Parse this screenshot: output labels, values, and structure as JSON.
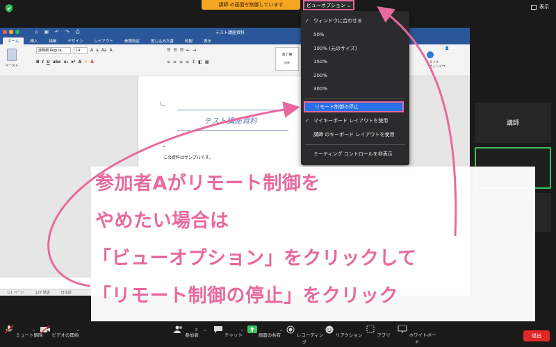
{
  "topbar": {
    "control_banner": "講師 の画面を制御しています",
    "view_option": "ビューオプション",
    "view_option_caret": "⌄",
    "right_view": "表示"
  },
  "word": {
    "title": "テスト講座資料",
    "tabs": [
      "ホーム",
      "挿入",
      "描画",
      "デザイン",
      "レイアウト",
      "参照設定",
      "差し込み文書",
      "校閲",
      "表示"
    ],
    "paste_label": "ペースト",
    "font_name": "游明朝 Regula...",
    "font_size": "14",
    "style_label": "あア亜",
    "style_name": "標準",
    "share_label": "共有",
    "side_label_1": "タイル",
    "side_label_2": "ウィンドウ",
    "doc_heading": "テスト講座資料",
    "doc_body": "この資料はサンプルです。",
    "status_page": "1/1 ページ",
    "status_words": "127 単語",
    "status_lang": "日本語"
  },
  "view_menu": {
    "items": [
      {
        "label": "ウィンドウに合わせる",
        "checked": true
      },
      {
        "label": "50%",
        "checked": false
      },
      {
        "label": "100% (元のサイズ)",
        "checked": false
      },
      {
        "label": "150%",
        "checked": false
      },
      {
        "label": "200%",
        "checked": false
      },
      {
        "label": "300%",
        "checked": false
      },
      {
        "label": "リモート制御の停止",
        "checked": false,
        "highlighted": true
      },
      {
        "label": "マイキーボード レイアウトを使用",
        "checked": true
      },
      {
        "label": "講師 のキーボード レイアウトを使用",
        "checked": false
      },
      {
        "label": "ミーティング コントロールを非表示",
        "checked": false
      }
    ]
  },
  "participants": {
    "host_name": "講師"
  },
  "annotation": {
    "lines": [
      "参加者Aがリモート制御を",
      "やめたい場合は",
      "「ビューオプション」をクリックして",
      "「リモート制御の停止」をクリック"
    ],
    "color": "#e8699e"
  },
  "toolbar": {
    "mute": "ミュート解除",
    "video": "ビデオの開始",
    "participants": "参加者",
    "participants_count": "3",
    "chat": "チャット",
    "share": "画面の共有",
    "record": "レコーディング",
    "reactions": "リアクション",
    "apps": "アプリ",
    "whiteboard": "ホワイトボード",
    "leave": "退出"
  },
  "colors": {
    "banner": "#f5a623",
    "highlight": "#2870e8",
    "annotation": "#e8699e",
    "share_green": "#3bc35a",
    "leave_red": "#e02828"
  }
}
